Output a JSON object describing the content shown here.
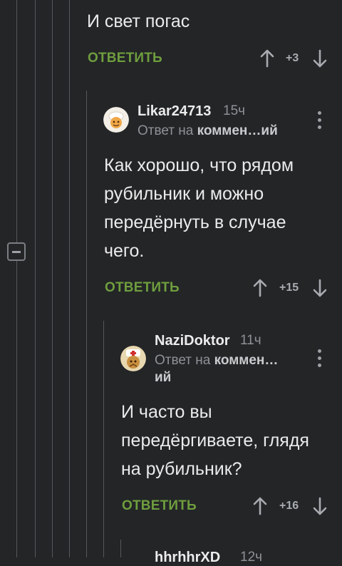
{
  "thread": {
    "top_comment": {
      "text": "И свет погас",
      "reply_label": "ОТВЕТИТЬ",
      "rating": "+3"
    },
    "comments": [
      {
        "author": "Likar24713",
        "time": "15ч",
        "reply_to_prefix": "Ответ на",
        "reply_to_link": "коммен…ий",
        "text_lines": [
          "Как хорошо, что рядом",
          "рубильник и можно",
          "передёрнуть в случае",
          "чего."
        ],
        "reply_label": "ОТВЕТИТЬ",
        "rating": "+15"
      },
      {
        "author": "NaziDoktor",
        "time": "11ч",
        "reply_to_prefix": "Ответ на",
        "reply_to_link": "коммен…",
        "reply_to_link_cont": "ий",
        "text_lines": [
          "И часто вы",
          "передёргиваете, глядя",
          "на рубильник?"
        ],
        "reply_label": "ОТВЕТИТЬ",
        "rating": "+16"
      },
      {
        "author": "hhrhhrXD",
        "time": "12ч"
      }
    ]
  },
  "icons": {
    "upvote": "arrow-up-icon",
    "downvote": "arrow-down-icon",
    "menu": "more-vertical-icon",
    "collapse": "minus-icon"
  },
  "colors": {
    "background": "#232527",
    "reply_green": "#6f9e3e",
    "thread_line": "#55585c"
  }
}
